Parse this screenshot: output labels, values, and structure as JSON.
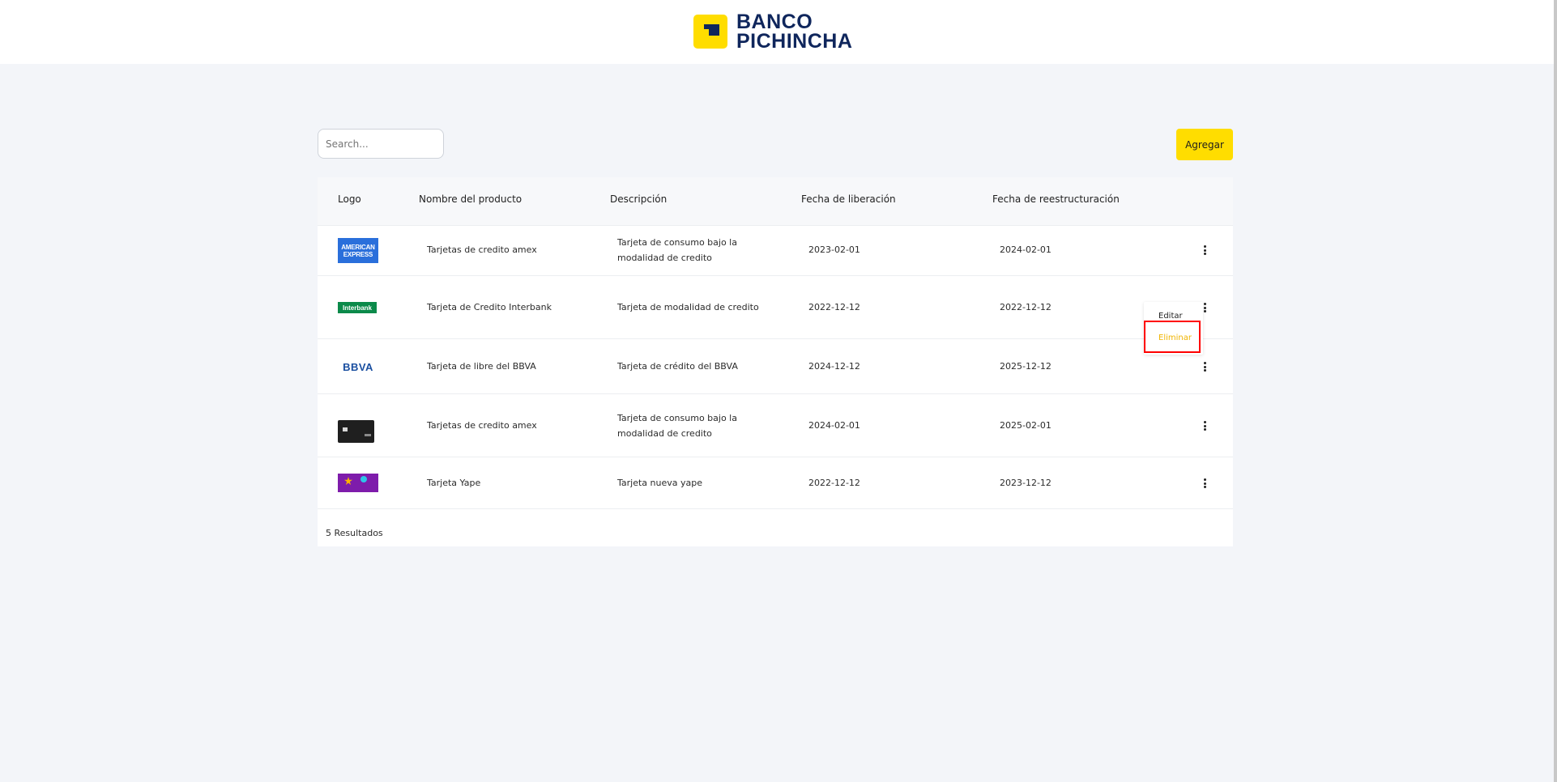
{
  "header": {
    "brand_line1": "BANCO",
    "brand_line2": "PICHINCHA",
    "colors": {
      "brand_yellow": "#ffdd00",
      "brand_navy": "#0f265c"
    }
  },
  "toolbar": {
    "search_placeholder": "Search...",
    "add_label": "Agregar"
  },
  "table": {
    "columns": [
      "Logo",
      "Nombre del producto",
      "Descripción",
      "Fecha de liberación",
      "Fecha de reestructuración"
    ],
    "rows": [
      {
        "logo": "american-express-logo",
        "logo_text_1": "AMERICAN",
        "logo_text_2": "EXPRESS",
        "name": "Tarjetas de credito amex",
        "description": "Tarjeta de consumo bajo la modalidad de credito",
        "release_date": "2023-02-01",
        "restructure_date": "2024-02-01"
      },
      {
        "logo": "interbank-logo",
        "logo_text_1": "Interbank",
        "name": "Tarjeta de Credito Interbank",
        "description": "Tarjeta de modalidad de credito",
        "release_date": "2022-12-12",
        "restructure_date": "2022-12-12"
      },
      {
        "logo": "bbva-logo",
        "logo_text_1": "BBVA",
        "name": "Tarjeta de libre del BBVA",
        "description": "Tarjeta de crédito del BBVA",
        "release_date": "2024-12-12",
        "restructure_date": "2025-12-12"
      },
      {
        "logo": "black-card-logo",
        "name": "Tarjetas de credito amex",
        "description": "Tarjeta de consumo bajo la modalidad de credito",
        "release_date": "2024-02-01",
        "restructure_date": "2025-02-01"
      },
      {
        "logo": "yape-logo",
        "name": "Tarjeta Yape",
        "description": "Tarjeta nueva yape",
        "release_date": "2022-12-12",
        "restructure_date": "2023-12-12"
      }
    ],
    "results_label": "5 Resultados"
  },
  "row_menu": {
    "edit_label": "Editar",
    "delete_label": "Eliminar",
    "colors": {
      "delete": "#f0b400",
      "highlight": "#ff0000"
    }
  }
}
